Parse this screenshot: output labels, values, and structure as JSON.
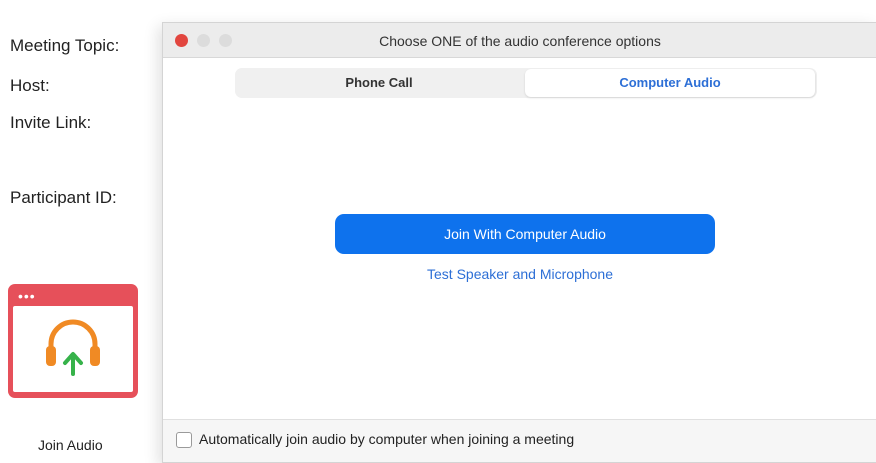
{
  "meeting_info": {
    "topic_label": "Meeting Topic:",
    "host_label": "Host:",
    "invite_label": "Invite Link:",
    "participant_label": "Participant ID:"
  },
  "join_audio": {
    "label": "Join Audio",
    "dots": "•••",
    "icon": "headphones-icon",
    "tile_color": "#e6505a",
    "headphones_color": "#f08a24",
    "arrow_color": "#36b24a"
  },
  "dialog": {
    "title": "Choose ONE of the audio conference options",
    "tabs": [
      {
        "label": "Phone Call",
        "selected": false
      },
      {
        "label": "Computer Audio",
        "selected": true
      }
    ],
    "join_button": "Join With Computer Audio",
    "test_link": "Test Speaker and Microphone",
    "auto_join_label": "Automatically join audio by computer when joining a meeting",
    "auto_join_checked": false,
    "accent_color": "#0e72ed"
  }
}
